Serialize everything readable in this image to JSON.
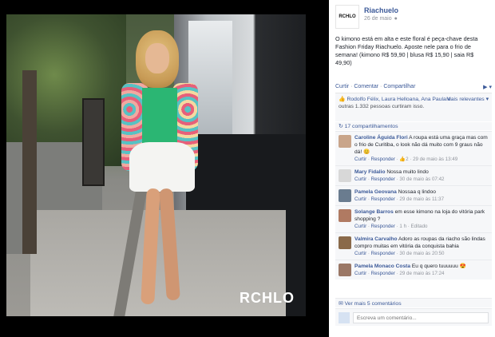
{
  "photo": {
    "watermark": "RCHLO"
  },
  "post": {
    "page_logo": "RCHLO",
    "page_name": "Riachuelo",
    "date": "26 de maio",
    "text": "O kimono está em alta e este floral é peça-chave desta Fashion Friday Riachuelo. Aposte nele para o frio de semana! (kimono R$ 59,90 | blusa R$ 15,90 | saia R$ 49,90)"
  },
  "actions": {
    "like": "Curtir",
    "comment": "Comentar",
    "share": "Compartilhar"
  },
  "likes": {
    "names": "Rodolfo Félix, Laura Helloana, Ana Paula e",
    "count_text": "outras 1.332 pessoas curtiram isso.",
    "relevant": "Mais relevantes"
  },
  "shares": {
    "label": "17 compartilhamentos"
  },
  "comments": [
    {
      "author": "Caroline Águida Flori",
      "text": "A roupa está uma graça mas com o frio de Curitiba, o look não dá muito com 9 graus não dá!",
      "like": "Curtir",
      "reply": "Responder",
      "likes": "2",
      "date": "29 de maio às 13:49",
      "avatar_color": "#c9a58a"
    },
    {
      "author": "Mary Fidalio",
      "text": "Nossa muito lindo",
      "like": "Curtir",
      "reply": "Responder",
      "likes": "",
      "date": "30 de maio às 07:42",
      "avatar_color": "#d8d8d8"
    },
    {
      "author": "Pamela Geovana",
      "text": "Nossaa q lindoo",
      "like": "Curtir",
      "reply": "Responder",
      "likes": "",
      "date": "29 de maio às 11:37",
      "avatar_color": "#6a7c8f"
    },
    {
      "author": "Solange Barros",
      "text": "em esse kimono na loja do vitória park shopping ?",
      "like": "Curtir",
      "reply": "Responder",
      "likes": "",
      "date": "1 h · Editado",
      "avatar_color": "#b07a62"
    },
    {
      "author": "Valmira Carvalho",
      "text": "Adoro as roupas da riacho são lindas compro muitas em vitória da conquista bahia",
      "like": "Curtir",
      "reply": "Responder",
      "likes": "",
      "date": "30 de maio às 20:50",
      "avatar_color": "#8a6a4a"
    },
    {
      "author": "Pamela Monaco Costa",
      "text": "Eu q quero tuuuuuu",
      "like": "Curtir",
      "reply": "Responder",
      "likes": "",
      "date": "29 de maio às 17:24",
      "avatar_color": "#9a7766"
    }
  ],
  "more_comments": "Ver mais 5 comentários",
  "write_comment": {
    "placeholder": "Escreva um comentário..."
  }
}
